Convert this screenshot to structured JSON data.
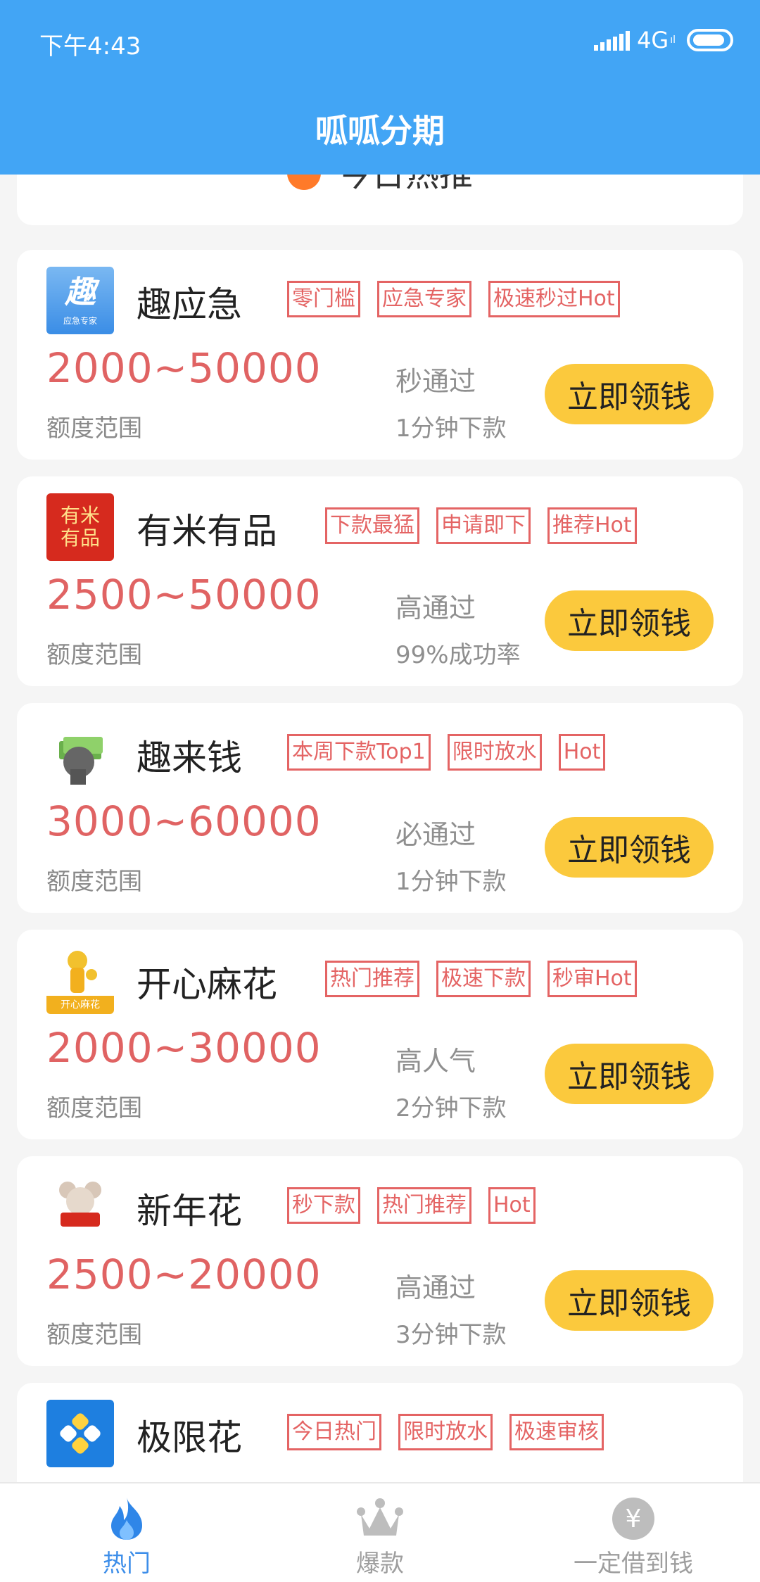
{
  "status_bar": {
    "time": "下午4:43",
    "network": "4G",
    "network_sub": "ıl"
  },
  "header": {
    "title": "呱呱分期"
  },
  "section": {
    "title": "今日热推"
  },
  "cards": [
    {
      "name": "趣应急",
      "logo_text": "趣",
      "logo_sub": "应急专家",
      "tags": [
        "零门槛",
        "应急专家",
        "极速秒过Hot"
      ],
      "amount": "2000~50000",
      "amount_label": "额度范围",
      "pass": "秒通过",
      "speed": "1分钟下款",
      "cta": "立即领钱"
    },
    {
      "name": "有米有品",
      "logo_text": "有米\n有品",
      "tags": [
        "下款最猛",
        "申请即下",
        "推荐Hot"
      ],
      "amount": "2500~50000",
      "amount_label": "额度范围",
      "pass": "高通过",
      "speed": "99%成功率",
      "cta": "立即领钱"
    },
    {
      "name": "趣来钱",
      "tags": [
        "本周下款Top1",
        "限时放水",
        "Hot"
      ],
      "amount": "3000~60000",
      "amount_label": "额度范围",
      "pass": "必通过",
      "speed": "1分钟下款",
      "cta": "立即领钱"
    },
    {
      "name": "开心麻花",
      "logo_sub": "开心麻花",
      "tags": [
        "热门推荐",
        "极速下款",
        "秒审Hot"
      ],
      "amount": "2000~30000",
      "amount_label": "额度范围",
      "pass": "高人气",
      "speed": "2分钟下款",
      "cta": "立即领钱"
    },
    {
      "name": "新年花",
      "tags": [
        "秒下款",
        "热门推荐",
        "Hot"
      ],
      "amount": "2500~20000",
      "amount_label": "额度范围",
      "pass": "高通过",
      "speed": "3分钟下款",
      "cta": "立即领钱"
    },
    {
      "name": "极限花",
      "tags": [
        "今日热门",
        "限时放水",
        "极速审核"
      ]
    }
  ],
  "tabbar": {
    "items": [
      {
        "label": "热门",
        "icon": "flame-icon",
        "active": true
      },
      {
        "label": "爆款",
        "icon": "crown-icon",
        "active": false
      },
      {
        "label": "一定借到钱",
        "icon": "yen-coin-icon",
        "active": false
      }
    ]
  },
  "colors": {
    "primary": "#42a5f5",
    "accent": "#fbc93d",
    "amount": "#e06363",
    "tag": "#e46464",
    "active_tab": "#3d8ee9"
  }
}
